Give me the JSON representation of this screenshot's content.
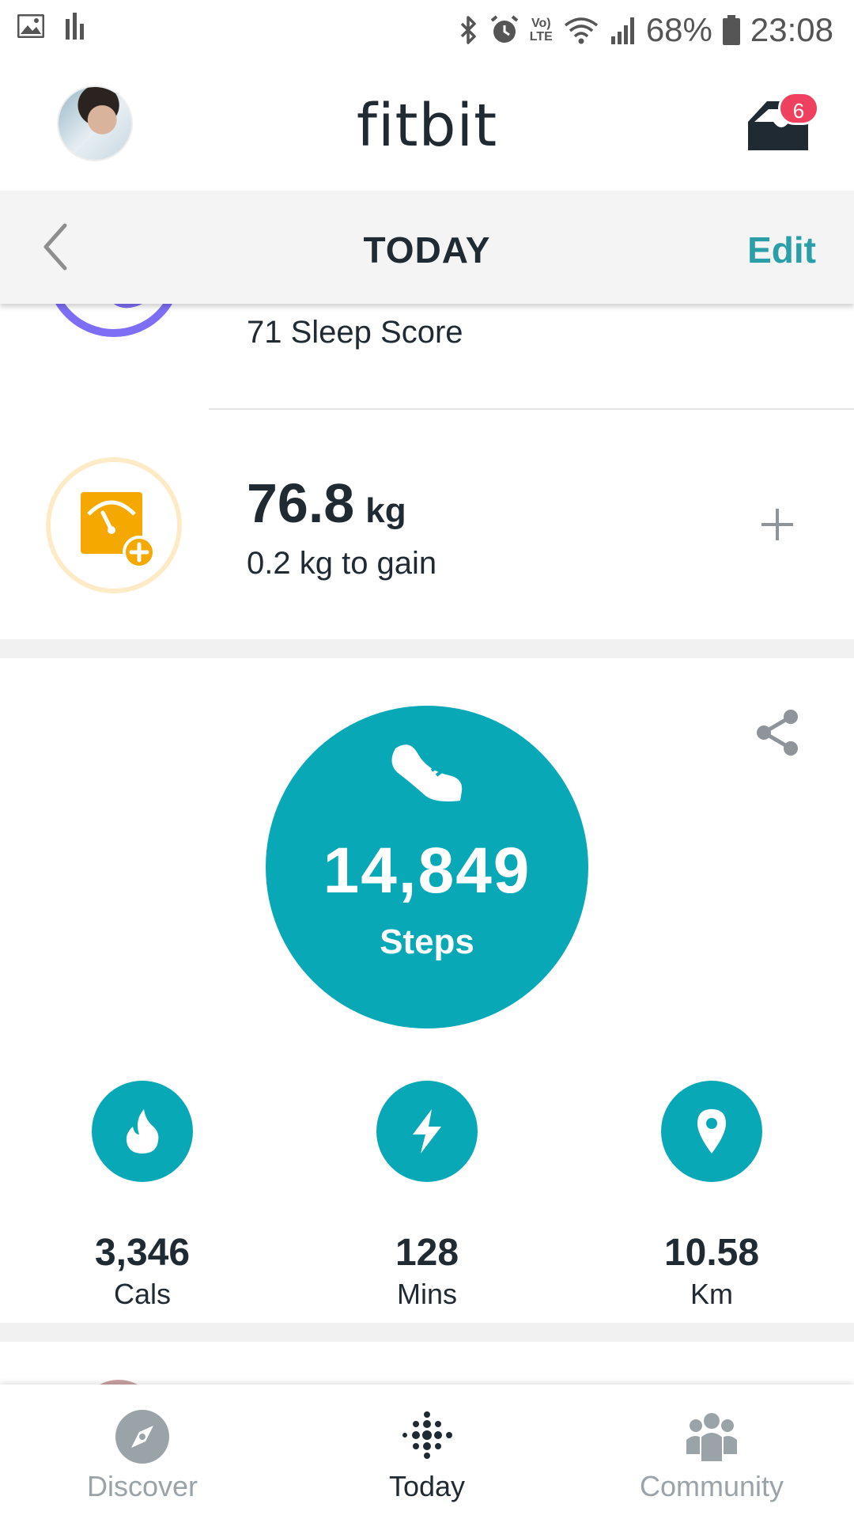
{
  "status_bar": {
    "volte_line1": "Vo)",
    "volte_line2": "LTE",
    "battery": "68%",
    "time": "23:08"
  },
  "header": {
    "brand": "fitbit",
    "inbox_count": "6"
  },
  "today_bar": {
    "title": "TODAY",
    "edit_label": "Edit"
  },
  "sleep": {
    "score_text": "71 Sleep Score"
  },
  "weight": {
    "value": "76.8",
    "unit": "kg",
    "subtitle": "0.2 kg to gain"
  },
  "steps": {
    "value": "14,849",
    "label": "Steps"
  },
  "stats": [
    {
      "value": "3,346",
      "unit": "Cals",
      "icon": "flame-icon"
    },
    {
      "value": "128",
      "unit": "Mins",
      "icon": "lightning-icon"
    },
    {
      "value": "10.58",
      "unit": "Km",
      "icon": "location-pin-icon"
    }
  ],
  "bottom_nav": [
    {
      "label": "Discover",
      "active": false
    },
    {
      "label": "Today",
      "active": true
    },
    {
      "label": "Community",
      "active": false
    }
  ],
  "colors": {
    "teal": "#08a8b6",
    "edit": "#2a9fa8",
    "sleep": "#7e6ef5",
    "weight": "#f5a800",
    "badge": "#f0405f"
  }
}
